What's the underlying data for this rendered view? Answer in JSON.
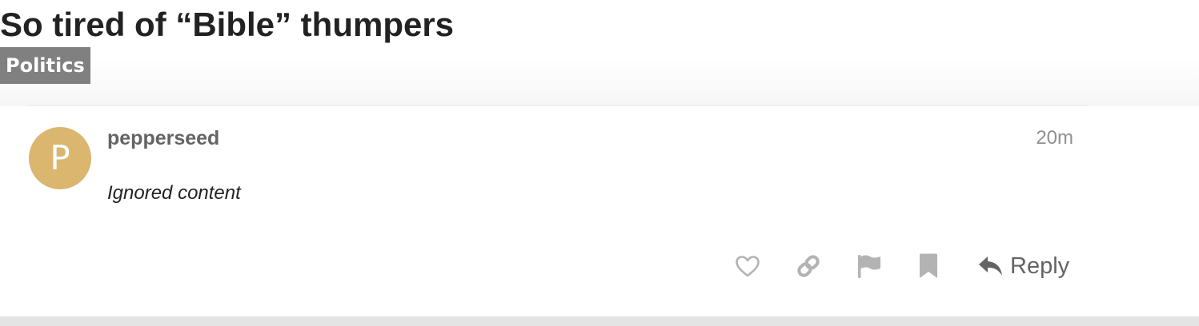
{
  "topic": {
    "title": "So tired of “Bible” thumpers",
    "category": "Politics"
  },
  "post": {
    "avatar_letter": "P",
    "avatar_color": "#dab66f",
    "username": "pepperseed",
    "date": "20m",
    "body": "Ignored content"
  },
  "actions": {
    "like_icon": "heart-icon",
    "link_icon": "link-icon",
    "flag_icon": "flag-icon",
    "bookmark_icon": "bookmark-icon",
    "reply_icon": "reply-icon",
    "reply_label": "Reply"
  },
  "colors": {
    "category_badge": "#808080",
    "icon_gray": "#b3b3b3",
    "reply_gray": "#646464"
  }
}
